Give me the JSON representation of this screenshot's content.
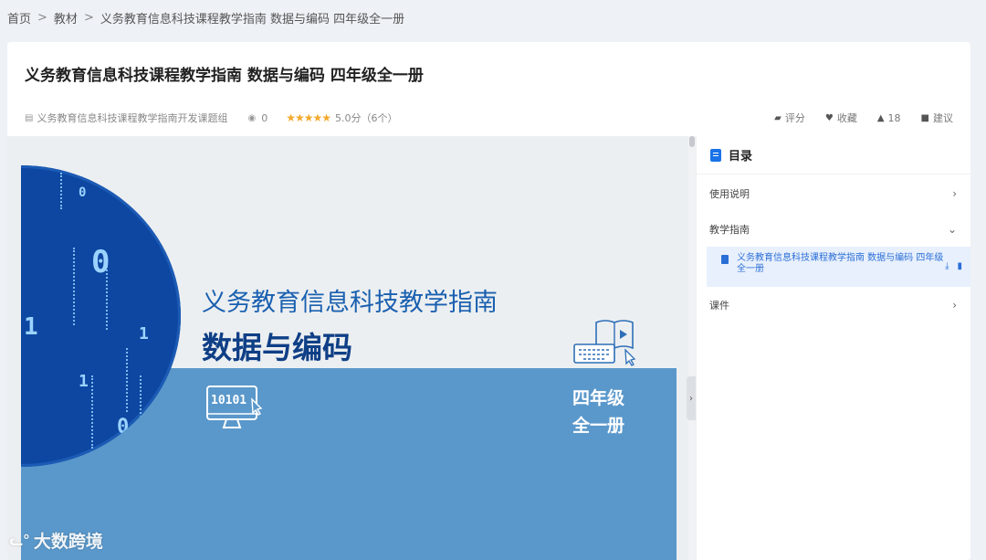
{
  "breadcrumb": {
    "home": "首页",
    "sep": ">",
    "category": "教材",
    "current": "义务教育信息科技课程教学指南 数据与编码 四年级全一册"
  },
  "header": {
    "title": "义务教育信息科技课程教学指南 数据与编码 四年级全一册",
    "author": "义务教育信息科技课程教学指南开发课题组",
    "views": "0",
    "stars": "★★★★★",
    "rating": "5.0分（6个）"
  },
  "actions": {
    "rate": "评分",
    "favorite": "收藏",
    "likes": "18",
    "suggest": "建议"
  },
  "cover": {
    "title_line1": "义务教育信息科技教学指南",
    "title_line2": "数据与编码",
    "grade_line1": "四年级",
    "grade_line2": "全一册",
    "monitor_text": "10101",
    "bits": [
      "0",
      "1",
      "0",
      "1",
      "1",
      "1",
      "0"
    ]
  },
  "toc": {
    "title": "目录",
    "items": [
      {
        "label": "使用说明",
        "arrow": "›"
      },
      {
        "label": "教学指南",
        "arrow": "⌄"
      },
      {
        "label": "课件",
        "arrow": "›"
      }
    ],
    "sub_item": "义务教育信息科技课程教学指南 数据与编码 四年级全一册"
  },
  "watermark": "大数跨境",
  "colors": {
    "accent": "#1a73e8",
    "cover_blue": "#5a98cb",
    "circle_blue": "#0d47a1",
    "star": "#f4a92b"
  }
}
